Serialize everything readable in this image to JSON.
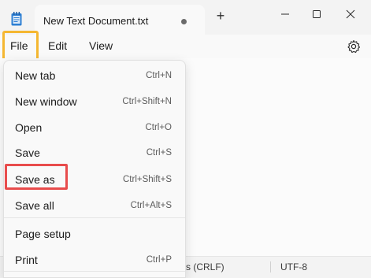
{
  "tab": {
    "title": "New Text Document.txt",
    "new_tab_label": "+"
  },
  "menubar": {
    "file": "File",
    "edit": "Edit",
    "view": "View"
  },
  "file_menu": {
    "items": [
      {
        "label": "New tab",
        "shortcut": "Ctrl+N"
      },
      {
        "label": "New window",
        "shortcut": "Ctrl+Shift+N"
      },
      {
        "label": "Open",
        "shortcut": "Ctrl+O"
      },
      {
        "label": "Save",
        "shortcut": "Ctrl+S"
      },
      {
        "label": "Save as",
        "shortcut": "Ctrl+Shift+S"
      },
      {
        "label": "Save all",
        "shortcut": "Ctrl+Alt+S"
      },
      {
        "label": "Page setup",
        "shortcut": ""
      },
      {
        "label": "Print",
        "shortcut": "Ctrl+P"
      }
    ]
  },
  "statusbar": {
    "line_ending": "s (CRLF)",
    "encoding": "UTF-8"
  },
  "colors": {
    "file_highlight": "#f5b731",
    "saveas_highlight": "#e84c4c",
    "app_icon": "#2d7fd3"
  },
  "icons": [
    "notepad-icon",
    "tab-modified-dot-icon",
    "minimize-icon",
    "maximize-icon",
    "close-icon",
    "gear-icon"
  ]
}
